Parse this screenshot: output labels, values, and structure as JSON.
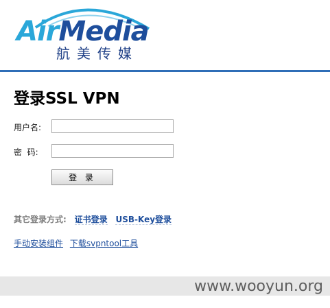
{
  "logo": {
    "word_a": "Air",
    "word_b": "Media",
    "chinese": "航美传媒",
    "colors": {
      "air": "#2aa7d9",
      "media": "#1e4e9c",
      "arc": "#2aa7d9"
    }
  },
  "page": {
    "title": "登录SSL VPN"
  },
  "form": {
    "username_label": "用户名:",
    "password_label": "密  码:",
    "username_value": "",
    "password_value": "",
    "login_button": "登 录"
  },
  "other_methods": {
    "label": "其它登录方式:",
    "cert_login": "证书登录",
    "usbkey_login": "USB-Key登录"
  },
  "links": {
    "manual_install": "手动安装组件",
    "download_tool": "下载svpntool工具"
  },
  "watermark": "www.wooyun.org",
  "colors": {
    "accent": "#2f6eb7",
    "link": "#1e4e9c",
    "footer_bg": "#e7e7e7"
  }
}
